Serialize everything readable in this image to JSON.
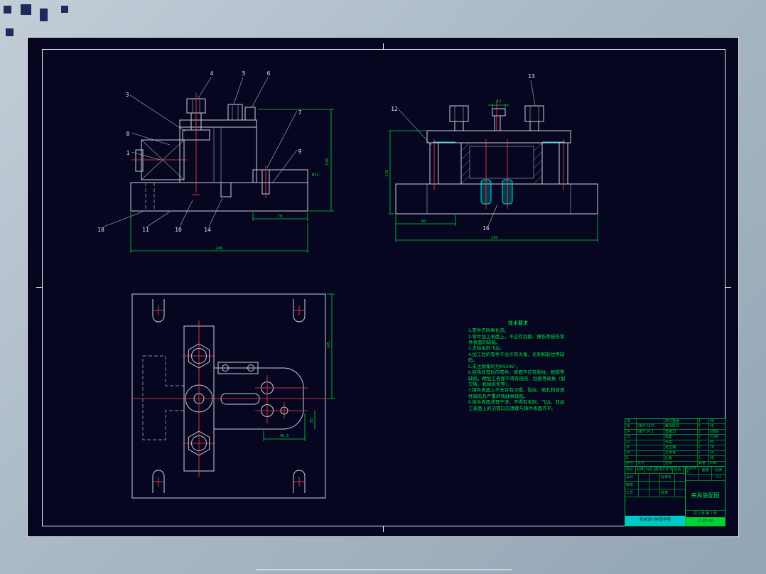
{
  "colors": {
    "background_top": "#c2cdd7",
    "background_bottom": "#92a5b5",
    "sheet": "#060621",
    "frame": "#eff0f2",
    "line": "#ccd0d6",
    "dimension": "#00d435",
    "centerline": "#ff4545",
    "highlight": "#00e2e2"
  },
  "views": {
    "front": {
      "callouts": [
        {
          "n": "3"
        },
        {
          "n": "4"
        },
        {
          "n": "5"
        },
        {
          "n": "6"
        },
        {
          "n": "7"
        },
        {
          "n": "9"
        },
        {
          "n": "8"
        },
        {
          "n": "1"
        },
        {
          "n": "18"
        },
        {
          "n": "11"
        },
        {
          "n": "10"
        },
        {
          "n": "14"
        }
      ],
      "dims": {
        "right": "120",
        "step": "78",
        "overall": "246",
        "thread": "M12"
      }
    },
    "side": {
      "callouts": [
        {
          "n": "12"
        },
        {
          "n": "13"
        },
        {
          "n": "16"
        }
      ],
      "dims": {
        "left": "115",
        "seg": "60",
        "overall": "285",
        "top": "12"
      }
    },
    "plan": {
      "dims": {
        "right": "145",
        "slot": "40.5",
        "offset": "25"
      }
    }
  },
  "notes": {
    "title": "技术要求",
    "lines": [
      "1.零件去除氧化皮。",
      "2.零件加工表面上，不应有划痕、擦伤等损伤零件表面的缺陷。",
      "3.去除毛刺飞边。",
      "4.加工后的零件不允许有尖角、毛刺和裂纹等缺陷。",
      "5.未注倒角均为R5X45°。",
      "6.经热处理后的零件，表面不应有裂纹、脱碳等缺陷，精加工表面不得有烧伤、划痕等现象（如欠铸、机械损伤等）。",
      "7.铸件表面上不允许有冷隔、裂纹、缩孔和穿透性缺陷及严重的残缺类缺陷。",
      "8.铸件表面清理干净，不得有毛刺、飞边，非加工表面上的浇冒口应清理与铸件表面齐平。"
    ]
  },
  "title_block": {
    "bom_header": {
      "no": "序号",
      "code": "代号",
      "name": "名称",
      "qty": "数量",
      "material": "材料"
    },
    "bom": [
      {
        "no": "18",
        "code": "",
        "name": "开口垫圈",
        "qty": "1",
        "material": "45"
      },
      {
        "no": "16",
        "code": "GB/T 6170",
        "name": "螺母M12",
        "qty": "1",
        "material": "45"
      },
      {
        "no": "14",
        "code": "GB/T 97.1",
        "name": "垫圈12",
        "qty": "2",
        "material": "65Mn"
      },
      {
        "no": "13",
        "code": "",
        "name": "钻套",
        "qty": "2",
        "material": "T10A"
      },
      {
        "no": "12",
        "code": "",
        "name": "衬套",
        "qty": "2",
        "material": "45"
      },
      {
        "no": "11",
        "code": "",
        "name": "定位销",
        "qty": "2",
        "material": "T8"
      },
      {
        "no": "10",
        "code": "",
        "name": "支承板",
        "qty": "1",
        "material": "45"
      },
      {
        "no": "9",
        "code": "",
        "name": "压板",
        "qty": "1",
        "material": "45"
      }
    ],
    "rev_header": [
      "标记",
      "处数",
      "分区",
      "更改文件号",
      "签名",
      "年月日"
    ],
    "sign_rows": [
      {
        "role": "设计",
        "extra": "标准化"
      },
      {
        "role": "审核",
        "extra": ""
      },
      {
        "role": "工艺",
        "extra": "批准"
      }
    ],
    "stage_label": "阶段标记",
    "weight_label": "重量",
    "scale_label": "比例",
    "scale_value": "1:1",
    "sheet_info": "共 1 张 第 1 张",
    "title": "夹具装配图",
    "org": "机械设计制造学院",
    "code": "JJ-ZP-00"
  }
}
